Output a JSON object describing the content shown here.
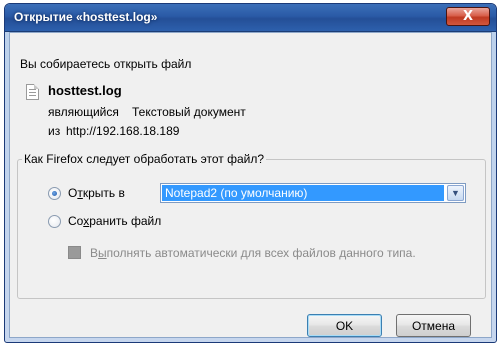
{
  "window": {
    "title": "Открытие «hosttest.log»",
    "close_label": "X"
  },
  "intro_text": "Вы собираетесь открыть файл",
  "file": {
    "name": "hosttest.log",
    "type_prefix": "являющийся",
    "type_value": "Текстовый документ",
    "source_prefix": "из",
    "source_url": "http://192.168.18.189",
    "icon": "text-file-icon"
  },
  "group": {
    "legend": "Как Firefox следует обработать этот файл?",
    "open_with": {
      "label_before": "О",
      "label_accel": "т",
      "label_after": "крыть в",
      "checked": true
    },
    "app_select": {
      "value": "Notepad2 (по умолчанию)"
    },
    "save_file": {
      "label_before": "Со",
      "label_accel": "х",
      "label_after": "ранить файл",
      "checked": false
    },
    "auto_action": {
      "label_before": "В",
      "label_accel": "ы",
      "label_after": "полнять автоматически для всех файлов данного типа.",
      "enabled": false
    }
  },
  "buttons": {
    "ok_label": "OK",
    "cancel_label": "Отмена"
  },
  "colors": {
    "titlebar": "#2a5aa6",
    "selection": "#3399ff",
    "close_button": "#c03a22"
  }
}
